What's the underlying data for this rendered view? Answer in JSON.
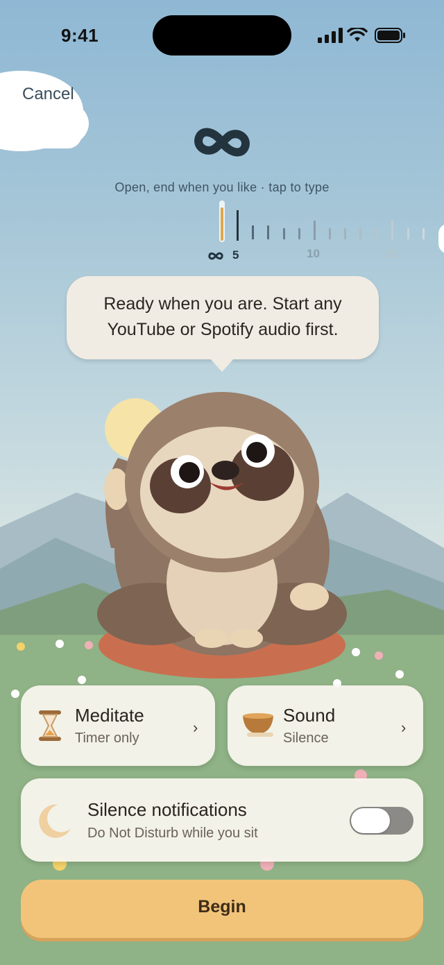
{
  "status_bar": {
    "time": "9:41"
  },
  "nav": {
    "cancel_label": "Cancel"
  },
  "duration": {
    "symbol": "∞",
    "subtitle": "Open, end when you like · tap to type",
    "scale_labels": [
      "∞",
      "5",
      "10",
      "15"
    ]
  },
  "bubble": {
    "line1": "Ready when you are. Start any",
    "line2": "YouTube or Spotify audio first."
  },
  "meditate_card": {
    "title": "Meditate",
    "subtitle": "Timer only",
    "icon": "hourglass-icon"
  },
  "sound_card": {
    "title": "Sound",
    "subtitle": "Silence",
    "icon": "singing-bowl-icon"
  },
  "silence_card": {
    "title": "Silence notifications",
    "subtitle": "Do Not Disturb while you sit",
    "icon": "moon-icon",
    "toggle_on": false
  },
  "begin_label": "Begin",
  "colors": {
    "accent": "#f1c47a",
    "card": "#faf6f0",
    "toggle_off": "#8c8a86"
  }
}
